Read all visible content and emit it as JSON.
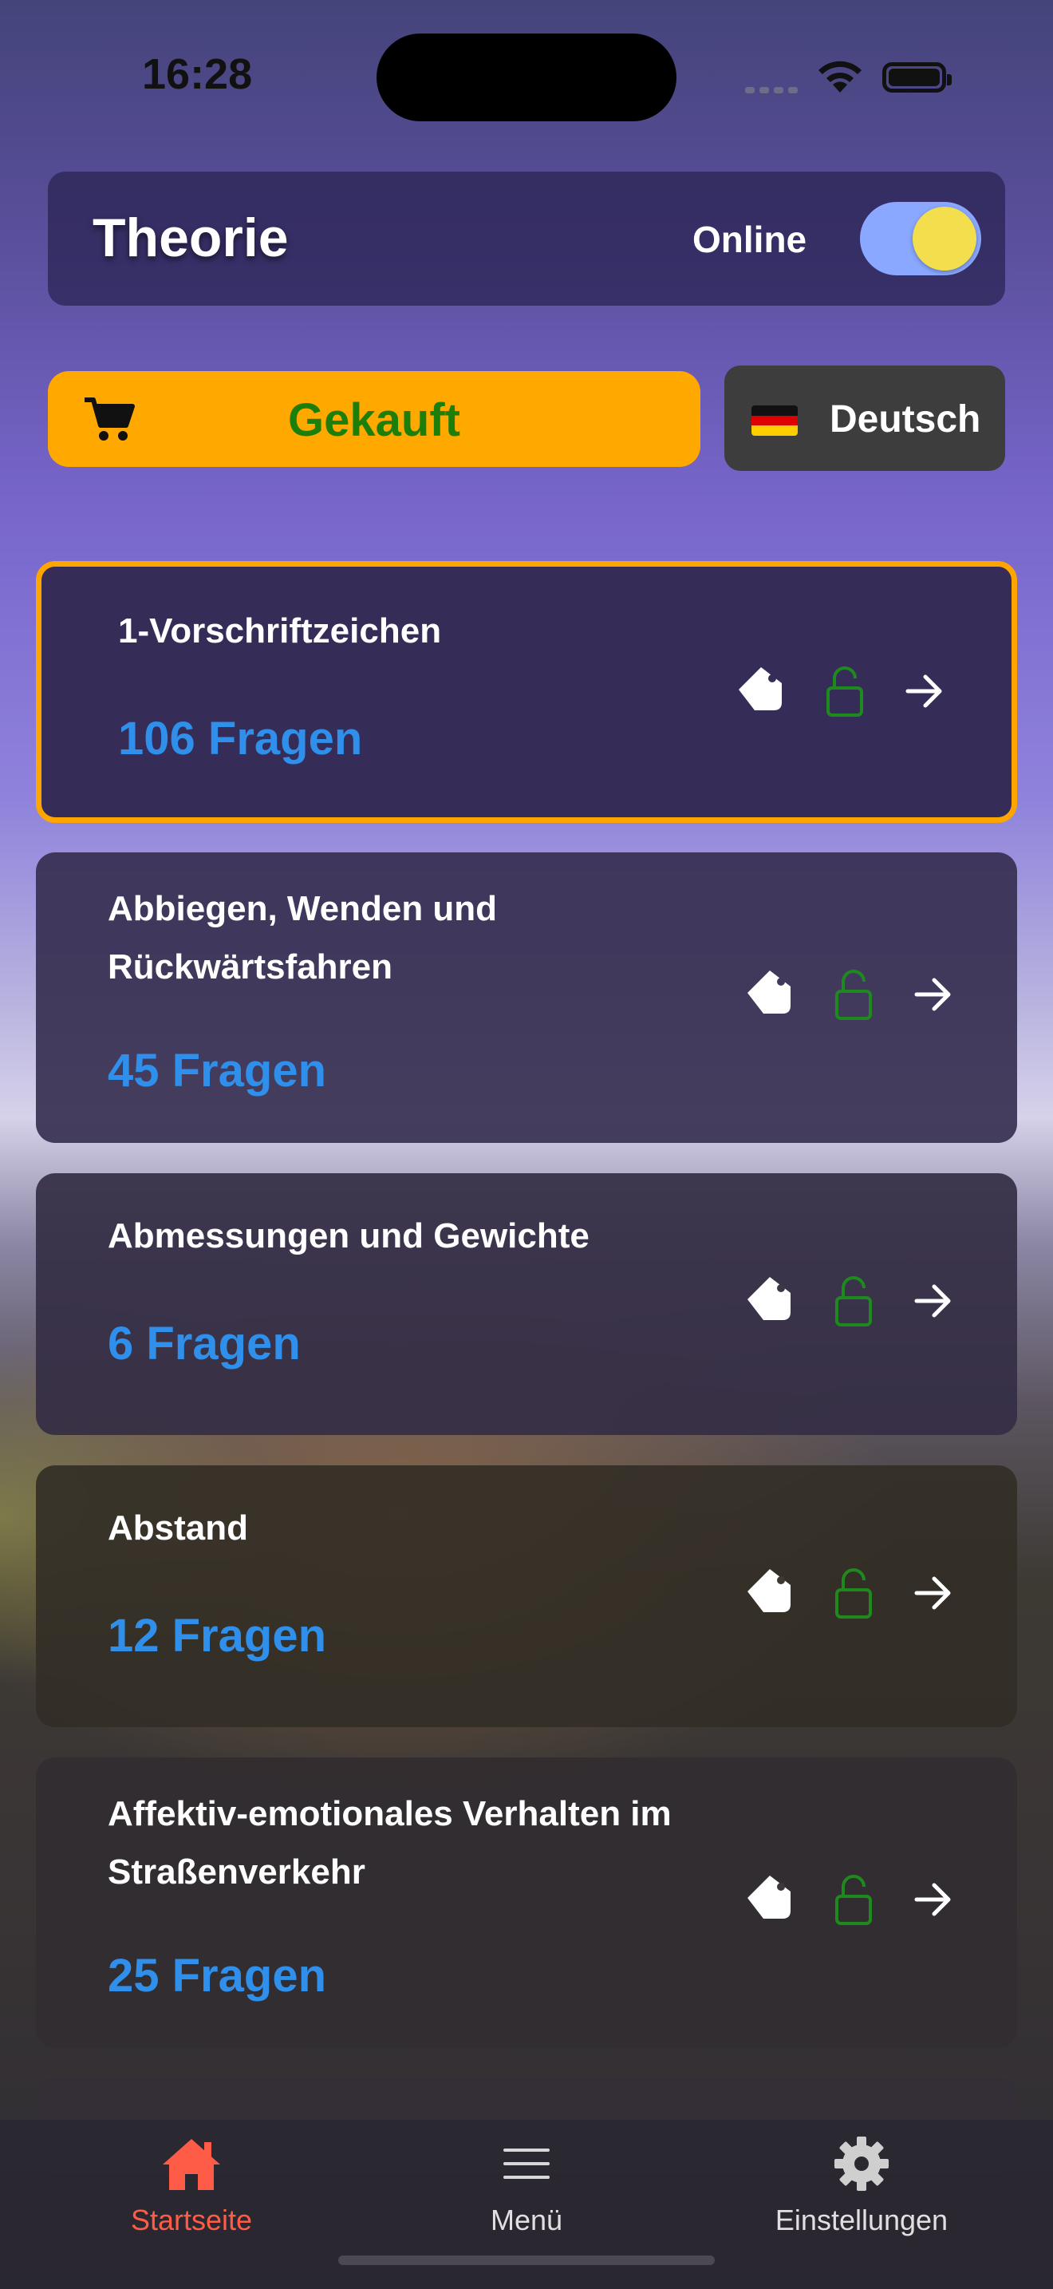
{
  "status_bar": {
    "time": "16:28"
  },
  "header": {
    "title": "Theorie",
    "online_label": "Online",
    "online_enabled": true
  },
  "actions": {
    "purchase_label": "Gekauft",
    "language_label": "Deutsch"
  },
  "categories": [
    {
      "name": "1-Vorschriftzeichen",
      "count": "106 Fragen",
      "selected": true
    },
    {
      "name": "Abbiegen, Wenden und Rückwärtsfahren",
      "count": "45 Fragen"
    },
    {
      "name": "Abmessungen und Gewichte",
      "count": "6 Fragen"
    },
    {
      "name": "Abstand",
      "count": "12 Fragen"
    },
    {
      "name": "Affektiv-emotionales Verhalten im Straßenverkehr",
      "count": "25 Fragen"
    }
  ],
  "bottom_nav": [
    {
      "label": "Startseite",
      "icon": "home-icon",
      "active": true
    },
    {
      "label": "Menü",
      "icon": "menu-icon"
    },
    {
      "label": "Einstellungen",
      "icon": "gear-icon"
    }
  ],
  "colors": {
    "accent_orange": "#ffa800",
    "purchased_green": "#1b7f0a",
    "count_blue": "#2f8fea",
    "unlock_green": "#1e8a1e",
    "active_tab": "#ff5c47"
  }
}
